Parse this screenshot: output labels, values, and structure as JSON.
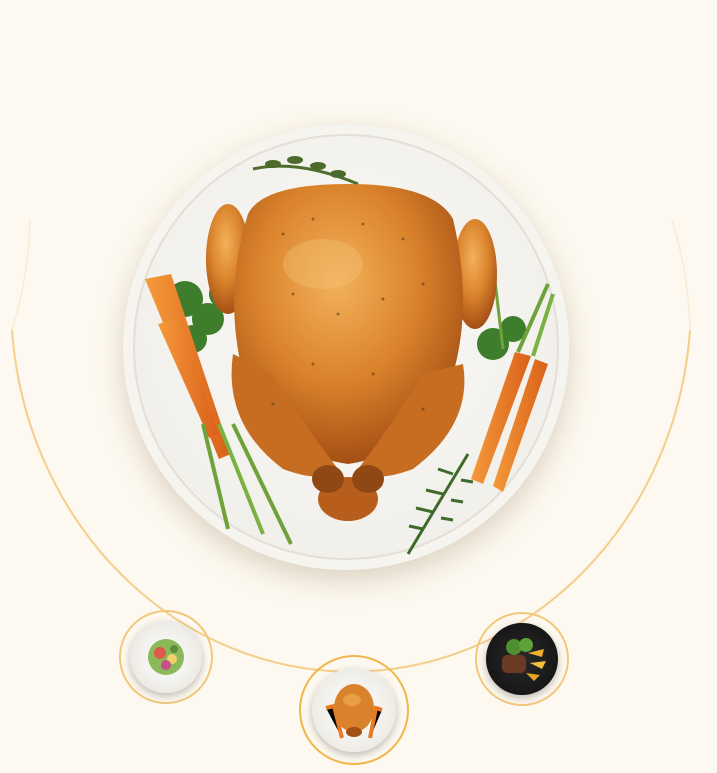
{
  "carousel": {
    "active_index": 1,
    "items": [
      {
        "icon": "salad-plate-icon",
        "selected": false
      },
      {
        "icon": "roast-chicken-plate-icon",
        "selected": true
      },
      {
        "icon": "steak-plate-icon",
        "selected": false
      }
    ]
  },
  "colors": {
    "background": "#fdf9f0",
    "arc": "#f2c77a",
    "plate": "#f1efea",
    "chicken": "#d9822b",
    "carrot": "#ea7a22",
    "herb": "#3d7d2b"
  }
}
